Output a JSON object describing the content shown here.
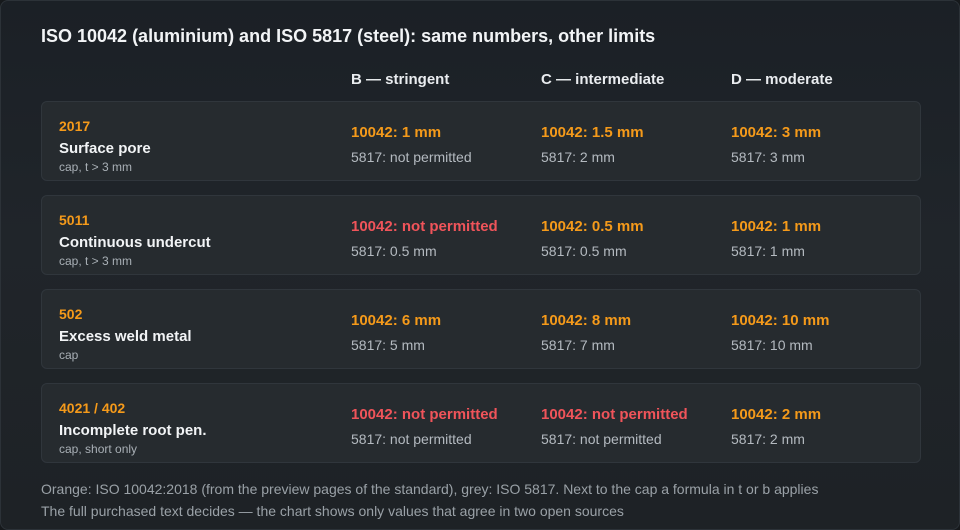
{
  "title": "ISO 10042 (aluminium) and ISO 5817 (steel): same numbers, other limits",
  "columns": [
    "B — stringent",
    "C — intermediate",
    "D — moderate"
  ],
  "colors": {
    "iso10042": "#f59a1a",
    "not_permitted": "#f0545a",
    "iso5817": "#b4bac0"
  },
  "rows": [
    {
      "code": "2017",
      "name": "Surface pore",
      "note": "cap, t > 3 mm",
      "cells": [
        {
          "iso10042": "10042: 1 mm",
          "iso5817": "5817: not permitted",
          "not_permitted": false
        },
        {
          "iso10042": "10042: 1.5 mm",
          "iso5817": "5817: 2 mm",
          "not_permitted": false
        },
        {
          "iso10042": "10042: 3 mm",
          "iso5817": "5817: 3 mm",
          "not_permitted": false
        }
      ]
    },
    {
      "code": "5011",
      "name": "Continuous undercut",
      "note": "cap, t > 3 mm",
      "cells": [
        {
          "iso10042": "10042: not permitted",
          "iso5817": "5817: 0.5 mm",
          "not_permitted": true
        },
        {
          "iso10042": "10042: 0.5 mm",
          "iso5817": "5817: 0.5 mm",
          "not_permitted": false
        },
        {
          "iso10042": "10042: 1 mm",
          "iso5817": "5817: 1 mm",
          "not_permitted": false
        }
      ]
    },
    {
      "code": "502",
      "name": "Excess weld metal",
      "note": "cap",
      "cells": [
        {
          "iso10042": "10042: 6 mm",
          "iso5817": "5817: 5 mm",
          "not_permitted": false
        },
        {
          "iso10042": "10042: 8 mm",
          "iso5817": "5817: 7 mm",
          "not_permitted": false
        },
        {
          "iso10042": "10042: 10 mm",
          "iso5817": "5817: 10 mm",
          "not_permitted": false
        }
      ]
    },
    {
      "code": "4021 / 402",
      "name": "Incomplete root pen.",
      "note": "cap, short only",
      "cells": [
        {
          "iso10042": "10042: not permitted",
          "iso5817": "5817: not permitted",
          "not_permitted": true
        },
        {
          "iso10042": "10042: not permitted",
          "iso5817": "5817: not permitted",
          "not_permitted": true
        },
        {
          "iso10042": "10042: 2 mm",
          "iso5817": "5817: 2 mm",
          "not_permitted": false
        }
      ]
    }
  ],
  "footer": [
    "Orange: ISO 10042:2018 (from the preview pages of the standard), grey: ISO 5817. Next to the cap a formula in t or b applies",
    "The full purchased text decides — the chart shows only values that agree in two open sources"
  ]
}
